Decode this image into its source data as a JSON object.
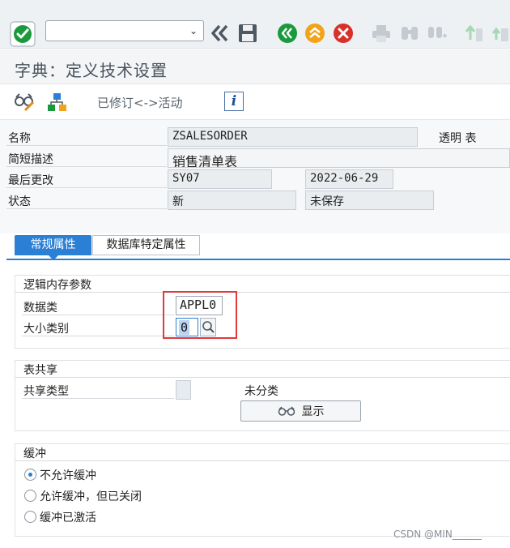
{
  "toolbar": {
    "command_field_value": "",
    "buttons": [
      "enter-icon",
      "back-double-icon",
      "save-icon",
      "back-icon",
      "exit-icon",
      "cancel-icon",
      "print-icon",
      "find-icon",
      "find-next-icon",
      "first-page-icon",
      "previous-page-icon"
    ]
  },
  "title": "字典：定义技术设置",
  "app_toolbar": {
    "revised_active_label": "已修订<->活动",
    "info_label": "i"
  },
  "header": {
    "name_label": "名称",
    "name_value": "ZSALESORDER",
    "table_type": "透明 表",
    "short_desc_label": "简短描述",
    "short_desc_value": "销售清单表",
    "last_changed_label": "最后更改",
    "last_changed_user": "SY07",
    "last_changed_date": "2022-06-29",
    "status_label": "状态",
    "status_value": "新",
    "save_status": "未保存"
  },
  "tabs": {
    "general": "常规属性",
    "db_specific": "数据库特定属性"
  },
  "logical_storage": {
    "title": "逻辑内存参数",
    "data_class_label": "数据类",
    "data_class_value": "APPL0",
    "size_category_label": "大小类别",
    "size_category_value": "0"
  },
  "table_sharing": {
    "title": "表共享",
    "share_type_label": "共享类型",
    "share_type_value": "",
    "unclassified": "未分类",
    "display_button": "显示"
  },
  "buffering": {
    "title": "缓冲",
    "options": [
      {
        "label": "不允许缓冲",
        "selected": true
      },
      {
        "label": "允许缓冲，但已关闭",
        "selected": false
      },
      {
        "label": "缓冲已激活",
        "selected": false
      }
    ]
  },
  "watermark": "CSDN @MIN______",
  "colors": {
    "accent": "#2b7fd4",
    "green": "#1a9a3c",
    "orange": "#f2a31a",
    "red": "#d9302a",
    "highlight": "#e03a3a"
  }
}
